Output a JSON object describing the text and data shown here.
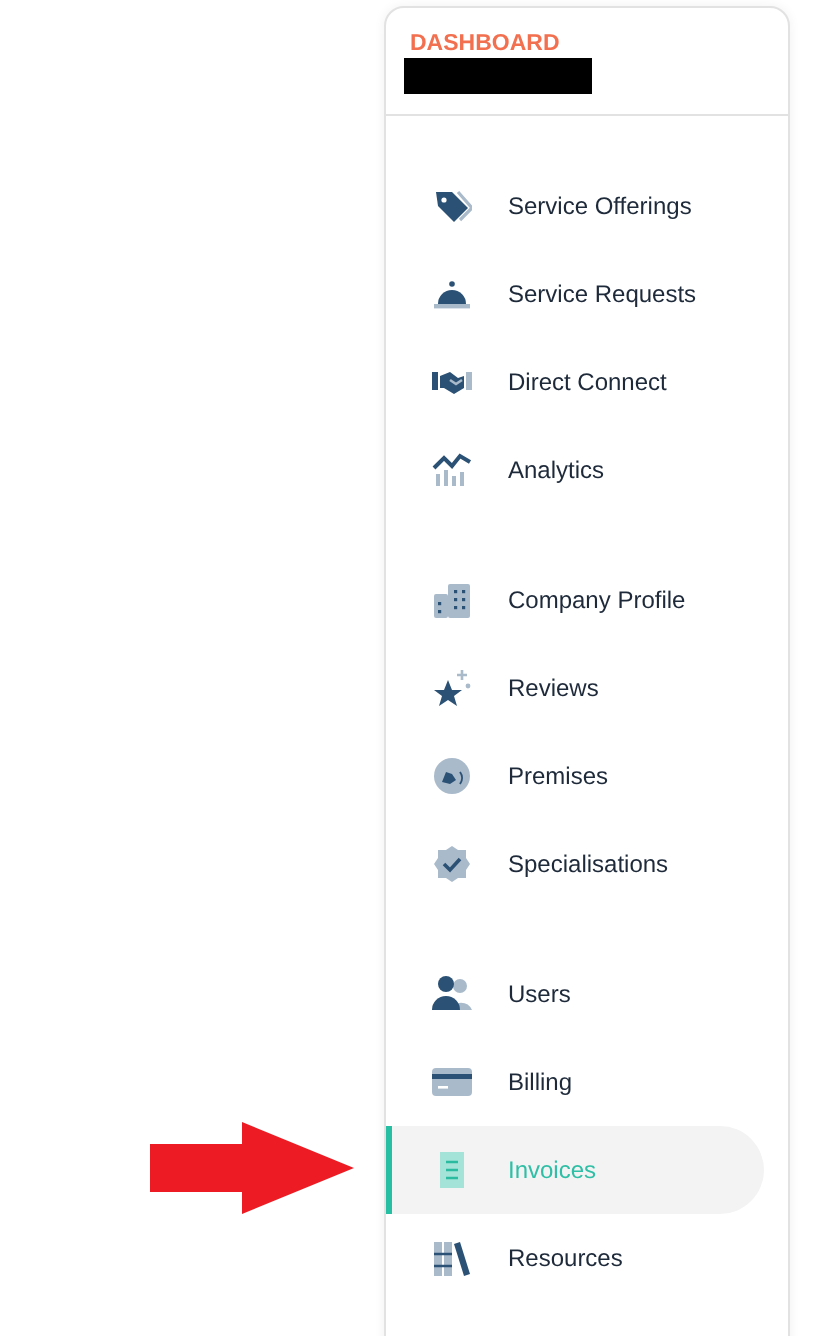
{
  "sidebar": {
    "title": "DASHBOARD",
    "groups": [
      {
        "items": [
          {
            "label": "Service Offerings",
            "selected": false
          },
          {
            "label": "Service Requests",
            "selected": false
          },
          {
            "label": "Direct Connect",
            "selected": false
          },
          {
            "label": "Analytics",
            "selected": false
          }
        ]
      },
      {
        "items": [
          {
            "label": "Company Profile",
            "selected": false
          },
          {
            "label": "Reviews",
            "selected": false
          },
          {
            "label": "Premises",
            "selected": false
          },
          {
            "label": "Specialisations",
            "selected": false
          }
        ]
      },
      {
        "items": [
          {
            "label": "Users",
            "selected": false
          },
          {
            "label": "Billing",
            "selected": false
          },
          {
            "label": "Invoices",
            "selected": true
          },
          {
            "label": "Resources",
            "selected": false
          }
        ]
      }
    ]
  }
}
